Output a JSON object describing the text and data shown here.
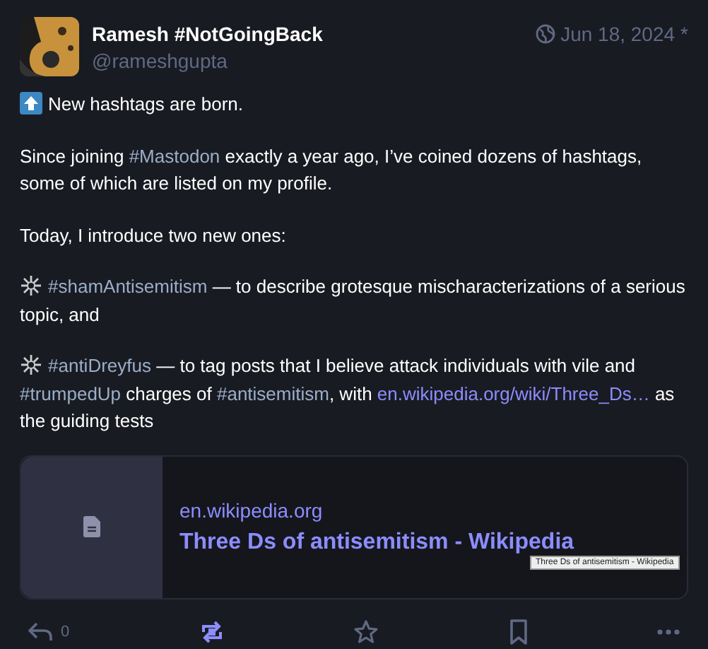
{
  "author": {
    "display_name": "Ramesh #NotGoingBack",
    "handle": "@rameshgupta"
  },
  "timestamp": "Jun 18, 2024",
  "edited_mark": "*",
  "paragraphs": [
    {
      "kind": "announcement",
      "segments": [
        {
          "kind": "text",
          "text": "New hashtags are born."
        }
      ]
    },
    {
      "segments": [
        {
          "kind": "text",
          "text": "Since joining "
        },
        {
          "kind": "hashtag",
          "text": "#Mastodon"
        },
        {
          "kind": "text",
          "text": " exactly a year ago, I’ve coined dozens of hashtags, some of which are listed on my profile."
        }
      ]
    },
    {
      "segments": [
        {
          "kind": "text",
          "text": "Today, I introduce two new ones:"
        }
      ]
    },
    {
      "kind": "item",
      "segments": [
        {
          "kind": "hashtag",
          "text": "#shamAntisemitism"
        },
        {
          "kind": "text",
          "text": " — to describe grotesque mischaracterizations of a serious topic, and"
        }
      ]
    },
    {
      "kind": "item",
      "segments": [
        {
          "kind": "hashtag",
          "text": "#antiDreyfus"
        },
        {
          "kind": "text",
          "text": " — to tag posts that I believe attack individuals with vile and "
        },
        {
          "kind": "hashtag",
          "text": "#trumpedUp"
        },
        {
          "kind": "text",
          "text": " charges of "
        },
        {
          "kind": "hashtag",
          "text": "#antisemitism"
        },
        {
          "kind": "text",
          "text": ", with "
        },
        {
          "kind": "link",
          "text": "en.wikipedia.org/wiki/Three_Ds…"
        },
        {
          "kind": "text",
          "text": " as the guiding tests"
        }
      ]
    }
  ],
  "link_card": {
    "domain": "en.wikipedia.org",
    "title": "Three Ds of antisemitism - Wikipedia",
    "tooltip": "Three Ds of antisemitism - Wikipedia"
  },
  "actions": [
    {
      "kind": "reply",
      "count": "0",
      "selected": false
    },
    {
      "kind": "boost",
      "selected": true
    },
    {
      "kind": "favourite",
      "selected": false
    },
    {
      "kind": "bookmark",
      "selected": false
    },
    {
      "kind": "more",
      "selected": false
    }
  ]
}
